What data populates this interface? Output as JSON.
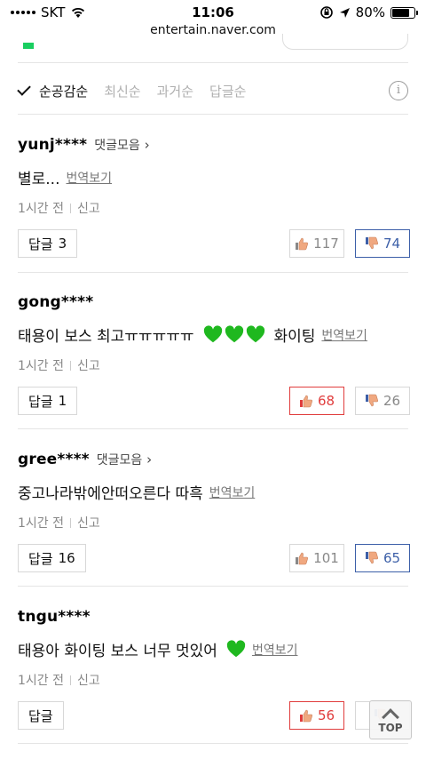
{
  "status_bar": {
    "carrier": "SKT",
    "time": "11:06",
    "battery": "80%",
    "battery_level": 0.8
  },
  "browser": {
    "url": "entertain.naver.com"
  },
  "sort": {
    "items": [
      {
        "label": "순공감순",
        "active": true
      },
      {
        "label": "최신순",
        "active": false
      },
      {
        "label": "과거순",
        "active": false
      },
      {
        "label": "답글순",
        "active": false
      }
    ],
    "info_icon": "i"
  },
  "comments": [
    {
      "user": "yunj****",
      "collect": "댓글모음",
      "text": "별로...",
      "translate": "번역보기",
      "time": "1시간 전",
      "report": "신고",
      "reply_label": "답글",
      "reply_count": "3",
      "likes": "117",
      "dislikes": "74",
      "highlight": "dislike",
      "hearts": 0
    },
    {
      "user": "gong****",
      "collect": "",
      "text": "태용이 보스 최고ㅠㅠㅠㅠㅠ",
      "text_after": "화이팅",
      "translate": "번역보기",
      "time": "1시간 전",
      "report": "신고",
      "reply_label": "답글",
      "reply_count": "1",
      "likes": "68",
      "dislikes": "26",
      "highlight": "like",
      "hearts": 3
    },
    {
      "user": "gree****",
      "collect": "댓글모음",
      "text": "중고나라밖에안떠오른다 따흑",
      "translate": "번역보기",
      "time": "1시간 전",
      "report": "신고",
      "reply_label": "답글",
      "reply_count": "16",
      "likes": "101",
      "dislikes": "65",
      "highlight": "dislike",
      "hearts": 0
    },
    {
      "user": "tngu****",
      "collect": "",
      "text": "태용아 화이팅 보스 너무 멋있어",
      "translate": "번역보기",
      "time": "1시간 전",
      "report": "신고",
      "reply_label": "답글",
      "reply_count": "",
      "likes": "56",
      "dislikes": "",
      "highlight": "like",
      "hearts": 1
    }
  ],
  "top_button": {
    "label": "TOP"
  },
  "colors": {
    "like_hot": "#e03c3c",
    "dislike_hot": "#3c5fa8",
    "heart": "#1fb81f"
  }
}
